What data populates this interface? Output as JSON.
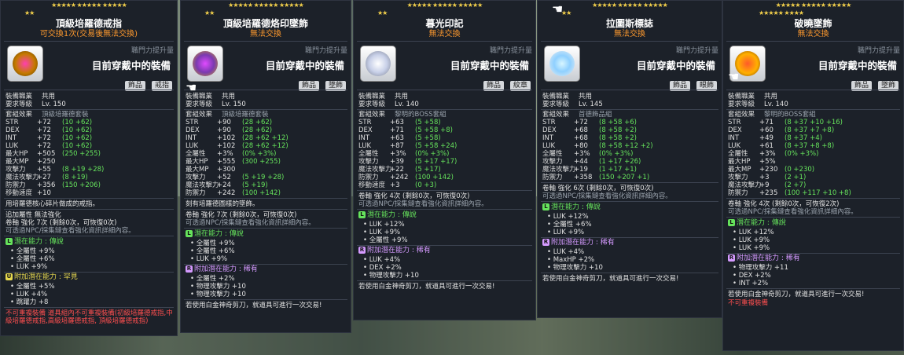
{
  "panels": [
    {
      "stars_row1": "★★★★★ ★★★★★ ★★★★★",
      "stars_row2": "★★",
      "title": "頂級培羅德戒指",
      "subtitle": "可交換1次(交易後無法交換)",
      "attack_label": "職門力提升量",
      "equipped_label": "目前穿戴中的裝備",
      "tags": [
        "飾品",
        "戒指"
      ],
      "job_label": "裝備職業",
      "job_value": "共用",
      "req_label": "要求等級",
      "req_value": "Lv. 150",
      "set_label": "套組效果",
      "set_value": "頂級培羅德套裝",
      "stats": [
        {
          "k": "STR",
          "base": "+72",
          "detail": "(10 +62)"
        },
        {
          "k": "DEX",
          "base": "+72",
          "detail": "(10 +62)"
        },
        {
          "k": "INT",
          "base": "+72",
          "detail": "(10 +62)"
        },
        {
          "k": "LUK",
          "base": "+72",
          "detail": "(10 +62)"
        },
        {
          "k": "最大HP",
          "base": "+505",
          "detail": "(250 +255)"
        },
        {
          "k": "最大MP",
          "base": "+250",
          "detail": ""
        },
        {
          "k": "攻擊力",
          "base": "+55",
          "detail": "(8 +19 +28)"
        },
        {
          "k": "魔法攻擊力",
          "base": "+27",
          "detail": "(8 +19)"
        },
        {
          "k": "防禦力",
          "base": "+356",
          "detail": "(150 +206)"
        },
        {
          "k": "移動速度",
          "base": "+10",
          "detail": ""
        }
      ],
      "desc": "用培羅德核心碎片做成的戒指。",
      "extra1": "追加屬性 無法強化",
      "extra2": "卷軸 強化 7次 (剩餘0次，可恢復0次)",
      "extra3": "可透過NPC/採集鏈查看強化資訊詳細內容。",
      "pot_title": "潛在能力 : 傳說",
      "pot_lines": [
        "• 全屬性 +9%",
        "• 全屬性 +6%",
        "• LUK +9%"
      ],
      "add_title": "附加潛在能力 : 罕見",
      "add_lines": [
        "• 全屬性 +5%",
        "• LUK +4%",
        "• 跳躍力 +8"
      ],
      "footer": "不可重複裝備   道具組內不可重複裝備(初級培羅德戒指,中級培羅德戒指,高級培羅德戒指, 頂級培羅德戒指)"
    },
    {
      "stars_row1": "★★★★★ ★★★★★ ★★★★★",
      "stars_row2": "★★",
      "title": "頂級培羅德烙印墜飾",
      "subtitle": "無法交換",
      "attack_label": "職門力提升量",
      "equipped_label": "目前穿戴中的裝備",
      "tags": [
        "飾品",
        "墜飾"
      ],
      "job_label": "裝備職業",
      "job_value": "共用",
      "req_label": "要求等級",
      "req_value": "Lv. 150",
      "set_label": "套組效果",
      "set_value": "頂級培羅德套裝",
      "stats": [
        {
          "k": "STR",
          "base": "+90",
          "detail": "(28 +62)"
        },
        {
          "k": "DEX",
          "base": "+90",
          "detail": "(28 +62)"
        },
        {
          "k": "INT",
          "base": "+102",
          "detail": "(28 +62 +12)"
        },
        {
          "k": "LUK",
          "base": "+102",
          "detail": "(28 +62 +12)"
        },
        {
          "k": "全屬性",
          "base": "+3%",
          "detail": "(0% +3%)"
        },
        {
          "k": "最大HP",
          "base": "+555",
          "detail": "(300 +255)"
        },
        {
          "k": "最大MP",
          "base": "+300",
          "detail": ""
        },
        {
          "k": "攻擊力",
          "base": "+52",
          "detail": "(5 +19 +28)"
        },
        {
          "k": "魔法攻擊力",
          "base": "+24",
          "detail": "(5 +19)"
        },
        {
          "k": "防禦力",
          "base": "+242",
          "detail": "(100 +142)"
        }
      ],
      "desc": "刻有培羅德圖樣的墜飾。",
      "extra1": "",
      "extra2": "卷軸 強化 7次 (剩餘0次，可恢復0次)",
      "extra3": "可透過NPC/採集鏈查看強化資訊詳細內容。",
      "pot_title": "潛在能力 : 傳說",
      "pot_lines": [
        "• 全屬性 +9%",
        "• 全屬性 +6%",
        "• LUK +9%"
      ],
      "add_title": "附加潛在能力 : 稀有",
      "add_lines": [
        "• 全屬性 +2%",
        "• 物理攻擊力 +10",
        "• 物理攻擊力 +10"
      ],
      "footer": "若使用白金神奇剪刀，就道具可進行一次交易!"
    },
    {
      "stars_row1": "★★★★★ ★★★★★ ★★★★★",
      "stars_row2": "★★",
      "title": "暮光印記",
      "subtitle": "無法交換",
      "attack_label": "職門力提升量",
      "equipped_label": "目前穿戴中的裝備",
      "tags": [
        "飾品",
        "紋章"
      ],
      "job_label": "裝備職業",
      "job_value": "共用",
      "req_label": "要求等級",
      "req_value": "Lv. 140",
      "set_label": "套組效果",
      "set_value": "黎明的BOSS套組",
      "stats": [
        {
          "k": "STR",
          "base": "+63",
          "detail": "(5 +58)"
        },
        {
          "k": "DEX",
          "base": "+71",
          "detail": "(5 +58 +8)"
        },
        {
          "k": "INT",
          "base": "+63",
          "detail": "(5 +58)"
        },
        {
          "k": "LUK",
          "base": "+87",
          "detail": "(5 +58 +24)"
        },
        {
          "k": "全屬性",
          "base": "+3%",
          "detail": "(0% +3%)"
        },
        {
          "k": "攻擊力",
          "base": "+39",
          "detail": "(5 +17 +17)"
        },
        {
          "k": "魔法攻擊力",
          "base": "+22",
          "detail": "(5 +17)"
        },
        {
          "k": "防禦力",
          "base": "+242",
          "detail": "(100 +142)"
        },
        {
          "k": "移動速度",
          "base": "+3",
          "detail": "(0 +3)"
        }
      ],
      "desc": "",
      "extra1": "",
      "extra2": "卷軸 強化 4次 (剩餘0次，可恢復0次)",
      "extra3": "可透過NPC/採集鏈查看強化資訊詳細內容。",
      "pot_title": "潛在能力 : 傳說",
      "pot_lines": [
        "• LUK +12%",
        "• LUK +9%",
        "• 全屬性 +9%"
      ],
      "add_title": "附加潛在能力 : 稀有",
      "add_lines": [
        "• LUK +4%",
        "• DEX +2%",
        "• 物理攻擊力 +10"
      ],
      "footer": "若使用白金神奇剪刀，就道具可進行一次交易!"
    },
    {
      "stars_row1": "★★★★★ ★★★★★ ★★★★★",
      "stars_row2": "★★",
      "title": "拉圖斯標誌",
      "subtitle": "無法交換",
      "attack_label": "職門力提升量",
      "equipped_label": "目前穿戴中的裝備",
      "tags": [
        "飾品",
        "眼飾"
      ],
      "job_label": "裝備職業",
      "job_value": "共用",
      "req_label": "要求等級",
      "req_value": "Lv. 145",
      "set_label": "套組效果",
      "set_value": "首德飾品組",
      "stats": [
        {
          "k": "STR",
          "base": "+72",
          "detail": "(8 +58 +6)"
        },
        {
          "k": "DEX",
          "base": "+68",
          "detail": "(8 +58 +2)"
        },
        {
          "k": "INT",
          "base": "+68",
          "detail": "(8 +58 +2)"
        },
        {
          "k": "LUK",
          "base": "+80",
          "detail": "(8 +58 +12 +2)"
        },
        {
          "k": "全屬性",
          "base": "+3%",
          "detail": "(0% +3%)"
        },
        {
          "k": "攻擊力",
          "base": "+44",
          "detail": "(1 +17 +26)"
        },
        {
          "k": "魔法攻擊力",
          "base": "+19",
          "detail": "(1 +17 +1)"
        },
        {
          "k": "防禦力",
          "base": "+358",
          "detail": "(150 +207 +1)"
        }
      ],
      "desc": "",
      "extra1": "",
      "extra2": "卷軸 強化 6次 (剩餘0次，可恢復0次)",
      "extra3": "可透過NPC/採集鏈查看強化資訊詳細內容。",
      "pot_title": "潛在能力 : 傳說",
      "pot_lines": [
        "• LUK +12%",
        "• 全屬性 +6%",
        "• LUK +9%"
      ],
      "add_title": "附加潛在能力 : 稀有",
      "add_lines": [
        "• LUK +4%",
        "• MaxHP +2%",
        "• 物理攻擊力 +10"
      ],
      "footer": "若使用白金神奇剪刀，就道具可進行一次交易!"
    },
    {
      "stars_row1": "★★★★★ ★★★★★ ★★★★★",
      "stars_row2": "★★★★★ ★★★★",
      "title": "破曉墜飾",
      "subtitle": "無法交換",
      "attack_label": "職門力提升量",
      "equipped_label": "目前穿戴中的裝備",
      "tags": [
        "飾品",
        "墜飾"
      ],
      "job_label": "裝備職業",
      "job_value": "共用",
      "req_label": "要求等級",
      "req_value": "Lv. 140",
      "set_label": "套組效果",
      "set_value": "黎明的BOSS套組",
      "stats": [
        {
          "k": "STR",
          "base": "+71",
          "detail": "(8 +37 +10 +16)"
        },
        {
          "k": "DEX",
          "base": "+60",
          "detail": "(8 +37 +7 +8)"
        },
        {
          "k": "INT",
          "base": "+49",
          "detail": "(8 +37 +4)"
        },
        {
          "k": "LUK",
          "base": "+61",
          "detail": "(8 +37 +8 +8)"
        },
        {
          "k": "全屬性",
          "base": "+3%",
          "detail": "(0% +3%)"
        },
        {
          "k": "最大HP",
          "base": "+5%",
          "detail": ""
        },
        {
          "k": "最大MP",
          "base": "+230",
          "detail": "(0 +230)"
        },
        {
          "k": "攻擊力",
          "base": "+3",
          "detail": "(2 +1)"
        },
        {
          "k": "魔法攻擊力",
          "base": "+9",
          "detail": "(2 +7)"
        },
        {
          "k": "防禦力",
          "base": "+235",
          "detail": "(100 +117 +10 +8)"
        }
      ],
      "desc": "",
      "extra1": "",
      "extra2": "卷軸 強化 4次 (剩餘0次，可恢復2次)",
      "extra3": "可透過NPC/採集鏈查看強化資訊詳細內容。",
      "pot_title": "潛在能力 : 傳說",
      "pot_lines": [
        "• LUK +12%",
        "• LUK +9%",
        "• LUK +9%"
      ],
      "add_title": "附加潛在能力 : 稀有",
      "add_lines": [
        "• 物理攻擊力 +11",
        "• DEX +2%",
        "• INT +2%"
      ],
      "footer": "若使用白金神奇剪刀，就道具可進行一次交易!",
      "footer2": "不可重複裝備"
    }
  ],
  "colors": {
    "star": "#f3d04b",
    "unique": "#e6d84f",
    "legend": "#66e35c",
    "rare": "#d59aff",
    "warning": "#ff4f4f",
    "untradeable": "#ff9a2e"
  }
}
